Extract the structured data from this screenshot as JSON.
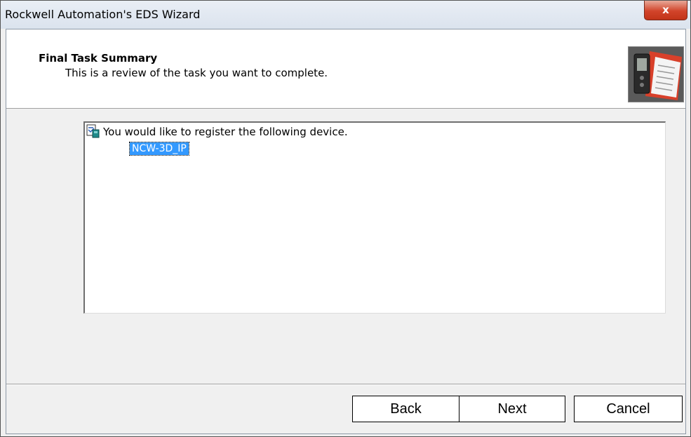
{
  "window": {
    "title": "Rockwell Automation's EDS Wizard",
    "close_label": "x"
  },
  "header": {
    "title": "Final Task Summary",
    "subtitle": "This is a review of the task you want to complete.",
    "image_icon": "wizard-documents-image"
  },
  "summary": {
    "icon": "document-register-icon",
    "text": "You would like to register the following device.",
    "device": "NCW-3D_IP"
  },
  "buttons": {
    "back": "Back",
    "next": "Next",
    "cancel": "Cancel"
  },
  "colors": {
    "selection": "#3399ff",
    "close_button": "#d2442a"
  }
}
